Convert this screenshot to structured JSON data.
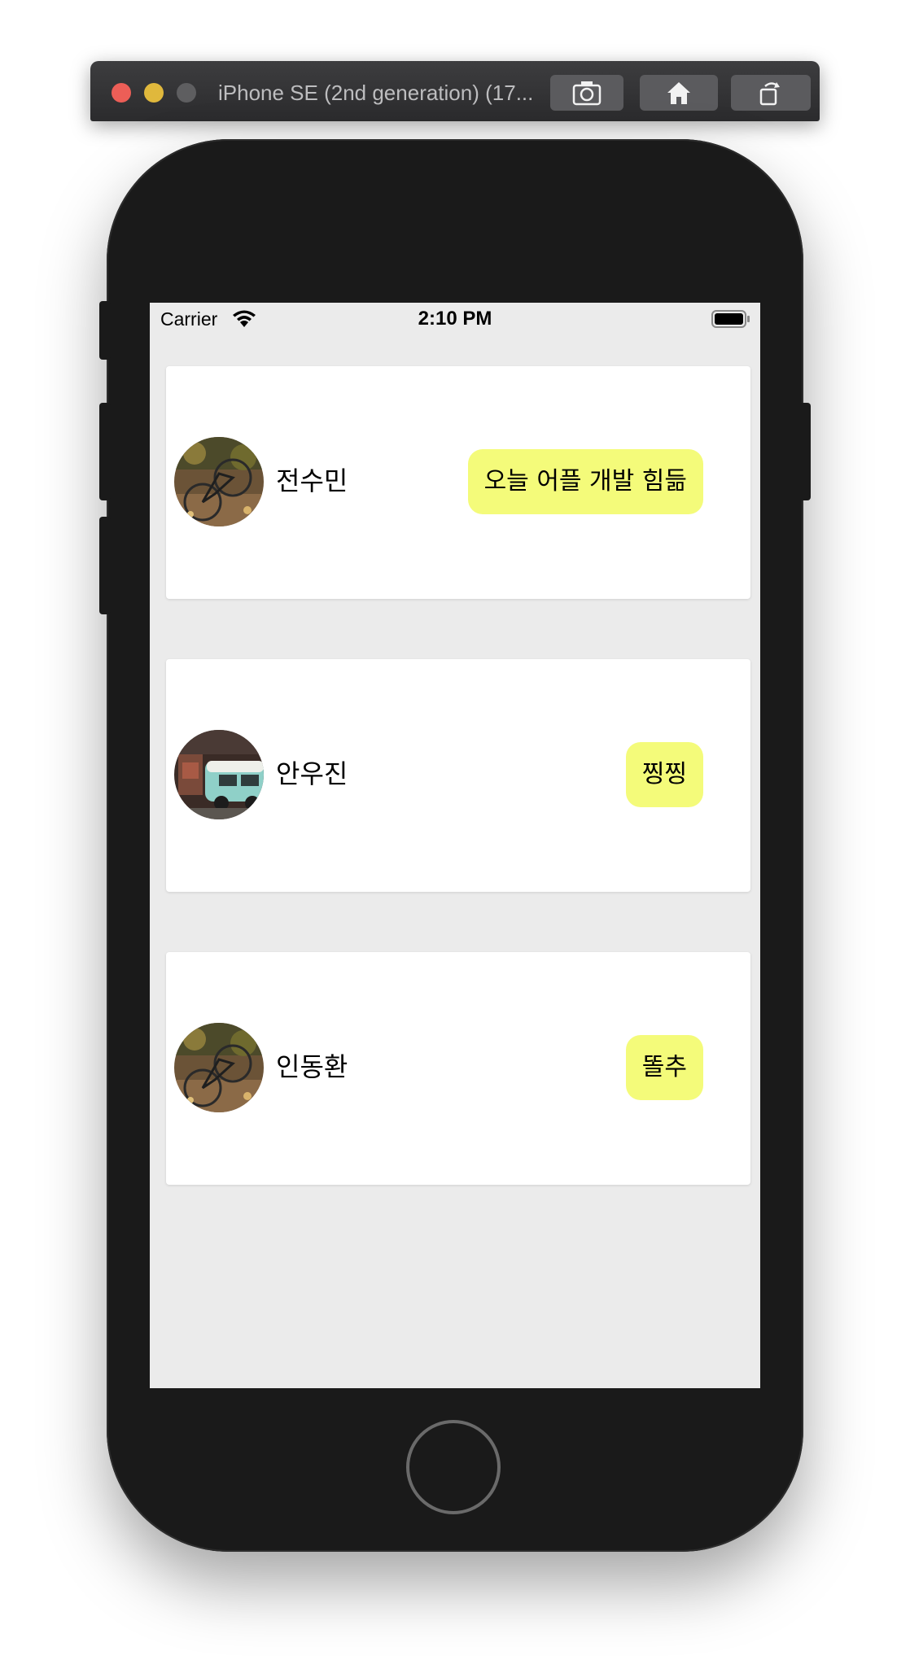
{
  "window": {
    "title": "iPhone SE (2nd generation) (17...",
    "toolbar": {
      "screenshot_icon": "camera-icon",
      "home_icon": "home-icon",
      "rotate_icon": "rotate-icon"
    }
  },
  "status_bar": {
    "carrier": "Carrier",
    "time": "2:10 PM",
    "wifi_icon": "wifi-icon",
    "battery_icon": "battery-icon"
  },
  "colors": {
    "bubble": "#f4fb7a",
    "screen_background": "#ebebeb",
    "card_background": "#ffffff",
    "phone_body": "#1a1a1a"
  },
  "messages": [
    {
      "name": "전수민",
      "message": "오늘 어플 개발 힘듦",
      "avatar": "bicycle-photo"
    },
    {
      "name": "안우진",
      "message": "찡찡",
      "avatar": "van-photo"
    },
    {
      "name": "인동환",
      "message": "똘추",
      "avatar": "bicycle-photo"
    }
  ]
}
